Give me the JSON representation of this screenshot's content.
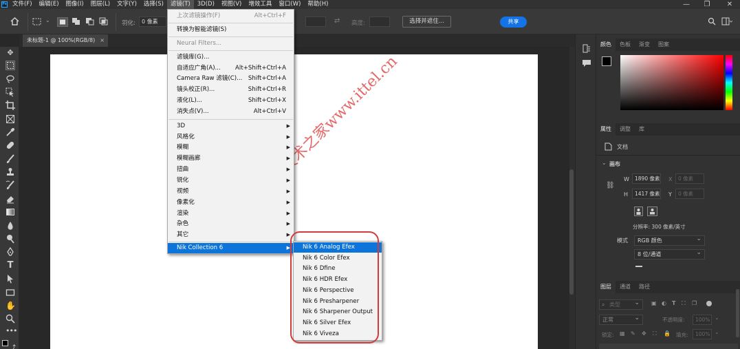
{
  "app_icon": "Ps",
  "menubar": {
    "items": [
      "文件(F)",
      "编辑(E)",
      "图像(I)",
      "图层(L)",
      "文字(Y)",
      "选择(S)",
      "滤镜(T)",
      "3D(D)",
      "视图(V)",
      "增效工具",
      "窗口(W)",
      "帮助(H)"
    ],
    "active_index": 6
  },
  "window_controls": [
    "minimize-icon",
    "restore-icon",
    "close-icon"
  ],
  "options_bar": {
    "feather_label": "羽化:",
    "feather_value": "0 像素",
    "height_label": "高度:",
    "select_and_mask": "选择并遮住...",
    "share": "共享"
  },
  "document_tab": {
    "title": "未标题-1 @ 100%(RGB/8)",
    "close": "×"
  },
  "filter_menu": {
    "recent": {
      "label": "上次滤镜操作(F)",
      "shortcut": "Alt+Ctrl+F"
    },
    "smart": {
      "label": "转换为智能滤镜(S)"
    },
    "neural": {
      "label": "Neural Filters..."
    },
    "group_a": [
      {
        "label": "滤镜库(G)...",
        "shortcut": ""
      },
      {
        "label": "自适应广角(A)...",
        "shortcut": "Alt+Shift+Ctrl+A"
      },
      {
        "label": "Camera Raw 滤镜(C)...",
        "shortcut": "Shift+Ctrl+A"
      },
      {
        "label": "镜头校正(R)...",
        "shortcut": "Shift+Ctrl+R"
      },
      {
        "label": "液化(L)...",
        "shortcut": "Shift+Ctrl+X"
      },
      {
        "label": "消失点(V)...",
        "shortcut": "Alt+Ctrl+V"
      }
    ],
    "group_b": [
      "3D",
      "风格化",
      "模糊",
      "模糊画廊",
      "扭曲",
      "锐化",
      "视频",
      "像素化",
      "渲染",
      "杂色",
      "其它"
    ],
    "nik": "Nik Collection 6"
  },
  "nik_submenu": [
    "Nik 6 Analog Efex",
    "Nik 6 Color Efex",
    "Nik 6 Dfine",
    "Nik 6 HDR Efex",
    "Nik 6 Perspective",
    "Nik 6 Presharpener",
    "Nik 6 Sharpener Output",
    "Nik 6 Silver Efex",
    "Nik 6 Viveza"
  ],
  "color_panel": {
    "tabs": [
      "颜色",
      "色板",
      "渐变",
      "图案"
    ]
  },
  "properties_panel": {
    "tabs": [
      "属性",
      "调整",
      "库"
    ],
    "doc_label": "文档",
    "section": "画布",
    "w_label": "W",
    "w_value": "1890 像素",
    "h_label": "H",
    "h_value": "1417 像素",
    "x_label": "X",
    "x_placeholder": "0 像素",
    "y_label": "Y",
    "y_placeholder": "0 像素",
    "resolution": "分辨率: 300 像素/英寸",
    "mode_label": "模式",
    "mode_value": "RGB 颜色",
    "depth_value": "8 位/通道"
  },
  "layers_panel": {
    "tabs": [
      "图层",
      "通道",
      "路径"
    ],
    "kind_filter": "类型",
    "blend_mode": "正常",
    "opacity_label": "不透明度:",
    "opacity_value": "100%",
    "lock_label": "锁定:",
    "fill_label": "填充:",
    "fill_value": "100%"
  },
  "watermark": "IT技术之家www.ittel.cn",
  "colors": {
    "accent": "#0d74d9",
    "share": "#1473e6",
    "annotation": "#d23b3b"
  }
}
